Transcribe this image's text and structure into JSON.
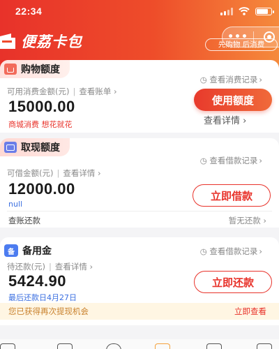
{
  "status": {
    "time": "22:34"
  },
  "app": {
    "name": "便荔卡包",
    "slogan": "先购物 后消费",
    "menu_dots": "•••"
  },
  "shopping": {
    "title": "购物额度",
    "record_link": "查看消费记录",
    "available_label": "可用消费金额(元)",
    "bill_link": "查看账单",
    "amount": "15000.00",
    "tagline": "商城消费 想花就花",
    "use_button": "使用额度",
    "detail_link": "查看详情"
  },
  "cash": {
    "title": "取现额度",
    "record_link": "查看借款记录",
    "available_label": "可借金额(元)",
    "detail_link": "查看详情",
    "amount": "12000.00",
    "note": "null",
    "borrow_button": "立即借款",
    "bill_label": "查账还款",
    "repay_status": "暂无还款"
  },
  "reserve": {
    "title": "备用金",
    "icon_char": "备",
    "record_link": "查看借款记录",
    "due_label": "待还款(元)",
    "detail_link": "查看详情",
    "amount": "5424.90",
    "last_repay": "最后还款日4月27日",
    "repay_button": "立即还款"
  },
  "banner": {
    "text": "您已获得再次提现机会",
    "link": "立即查看"
  },
  "colors": {
    "brand_red": "#e8322a",
    "brand_orange": "#f58a3c",
    "banner_bg": "#fff6e3",
    "reserve_blue": "#4c7cf0"
  }
}
